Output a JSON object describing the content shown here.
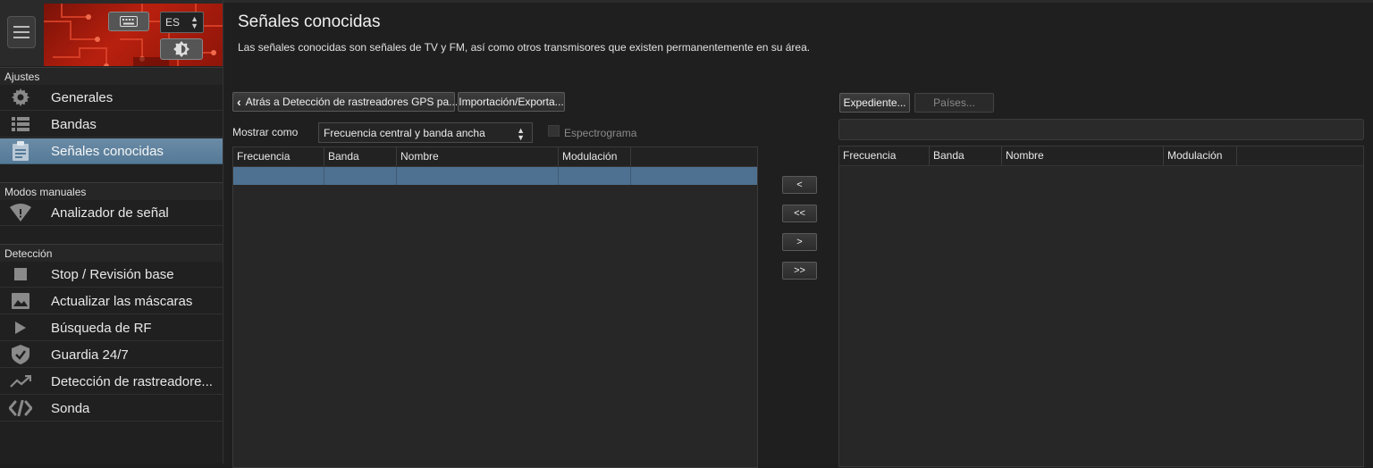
{
  "sidebar": {
    "language": "ES",
    "sections": [
      {
        "title": "Ajustes",
        "items": [
          {
            "label": "Generales",
            "icon": "gear-icon"
          },
          {
            "label": "Bandas",
            "icon": "list-icon"
          },
          {
            "label": "Señales conocidas",
            "icon": "clipboard-icon",
            "selected": true
          }
        ]
      },
      {
        "title": "Modos manuales",
        "items": [
          {
            "label": "Analizador de señal",
            "icon": "wifi-info-icon"
          }
        ]
      },
      {
        "title": "Detección",
        "items": [
          {
            "label": "Stop / Revisión base",
            "icon": "stop-icon"
          },
          {
            "label": "Actualizar las máscaras",
            "icon": "image-icon"
          },
          {
            "label": "Búsqueda de RF",
            "icon": "play-icon"
          },
          {
            "label": "Guardia 24/7",
            "icon": "shield-check-icon"
          },
          {
            "label": "Detección de rastreadore...",
            "icon": "trend-icon"
          },
          {
            "label": "Sonda",
            "icon": "probe-icon"
          }
        ]
      }
    ]
  },
  "main": {
    "title": "Señales conocidas",
    "description": "Las señales conocidas son señales de TV y FM, así como otros transmisores que existen permanentemente en su área.",
    "back_button": "Atrás a Detección de rastreadores GPS pa...",
    "import_export_button": "Importación/Exporta...",
    "show_as_label": "Mostrar como",
    "display_mode": "Frecuencia central y banda ancha",
    "spectrogram_label": "Espectrograma",
    "spectrogram_checked": false,
    "file_button": "Expediente...",
    "countries_button": "Países...",
    "move_buttons": [
      "<",
      "<<",
      ">",
      ">>"
    ],
    "left_table": {
      "columns": [
        "Frecuencia",
        "Banda",
        "Nombre",
        "Modulación"
      ],
      "selected_row": [
        "",
        "",
        "",
        "",
        ""
      ]
    },
    "right_table": {
      "columns": [
        "Frecuencia",
        "Banda",
        "Nombre",
        "Modulación"
      ]
    }
  },
  "colors": {
    "selection": "#4f7191",
    "sidebar_selected": "#6a8ba6",
    "banner_red": "#b8200e",
    "background": "#1f1f1f"
  }
}
